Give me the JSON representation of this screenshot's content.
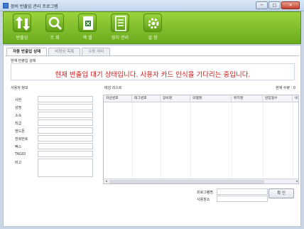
{
  "window": {
    "title": "장비 반출입 관리 프로그램",
    "buttons": [
      "─",
      "□",
      "✕"
    ]
  },
  "toolbar": {
    "items": [
      {
        "label": "반출입",
        "icon": "up-down-arrows-icon"
      },
      {
        "label": "조 회",
        "icon": "search-icon"
      },
      {
        "label": "엑 셀",
        "icon": "excel-icon"
      },
      {
        "label": "장치 관리",
        "icon": "device-list-icon"
      },
      {
        "label": "설 정",
        "icon": "gear-icon"
      }
    ]
  },
  "tabs": [
    {
      "label": "자동 반출입 상태",
      "active": true
    },
    {
      "label": "비정상 목록",
      "active": false
    },
    {
      "label": "수동 처리",
      "active": false
    }
  ],
  "status": {
    "group_label": "현재 반출입 상태",
    "message": "현재 반출입 대기 상태입니다. 사용자 카드 인식을 기다리는 중입니다."
  },
  "user_info": {
    "group_label": "사용자 정보",
    "fields": [
      "사번",
      "성명",
      "소속",
      "직급",
      "핸드폰",
      "전화번호",
      "팩스",
      "TAGID"
    ],
    "memo_label": "비고"
  },
  "list": {
    "group_label": "태깅 리스트",
    "count_label": "현재 수량 : 0",
    "columns": [
      "자산번호",
      "태그번호",
      "장비명",
      "모델명",
      "위치명",
      "반입일수",
      "비"
    ]
  },
  "bottom": {
    "program_label": "프로그램명",
    "location_label": "사용장소",
    "confirm_button": "확 인"
  }
}
